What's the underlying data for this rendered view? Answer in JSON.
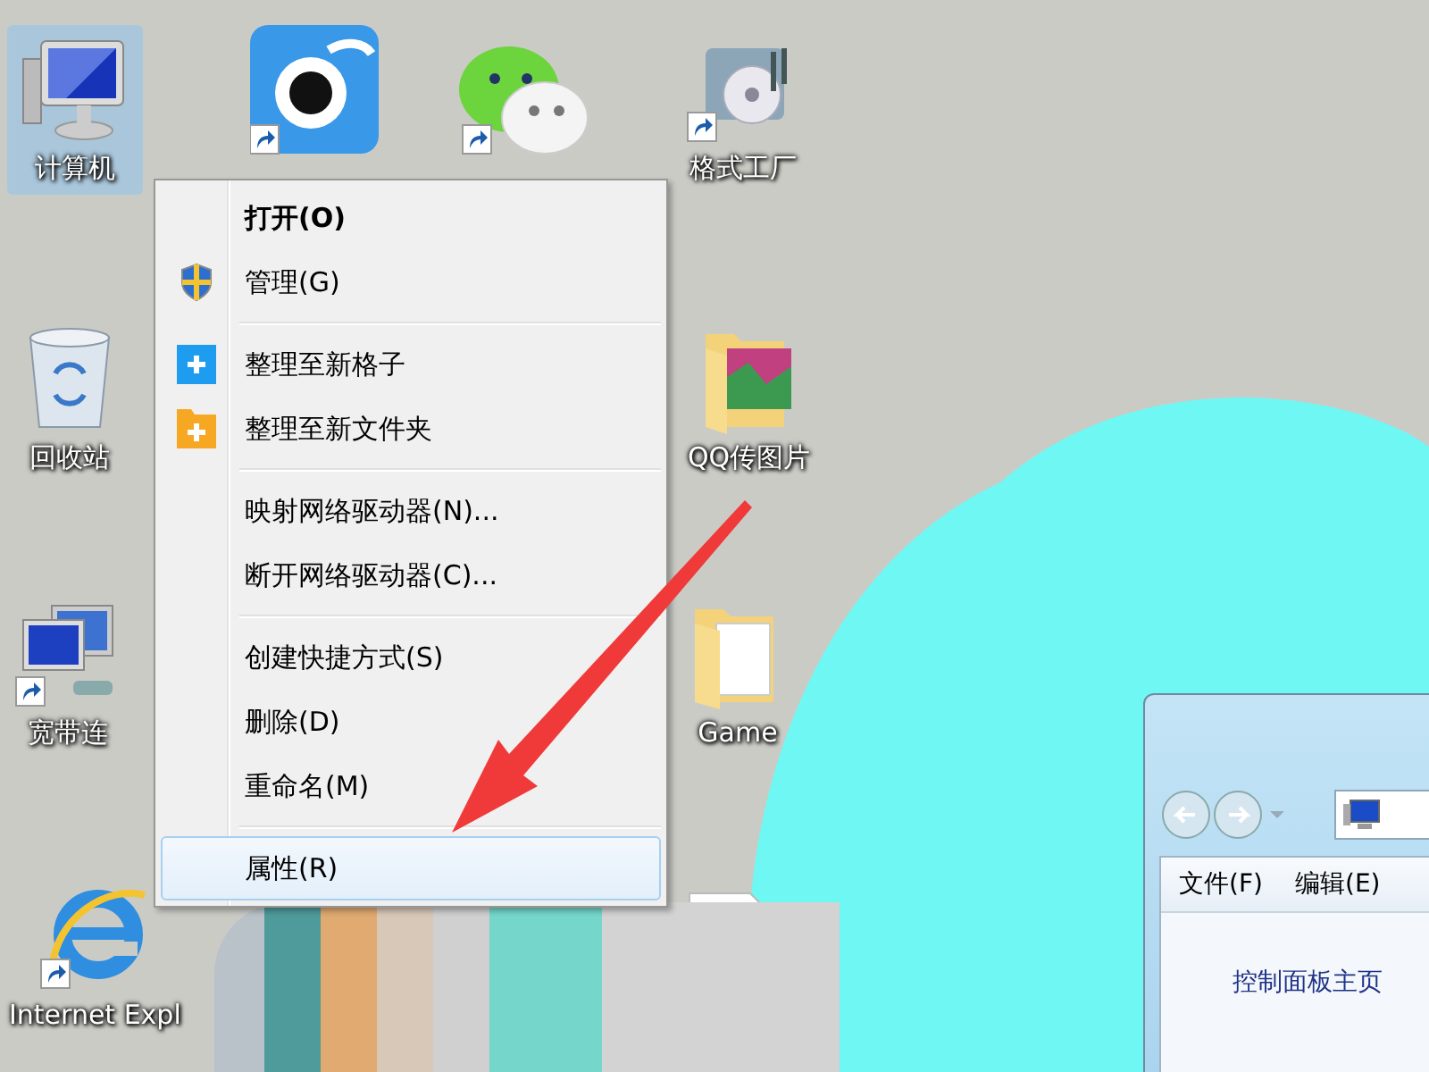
{
  "desktop_icons": [
    {
      "label": "计算机",
      "selected": true
    },
    {
      "label": "格式工厂",
      "selected": false
    },
    {
      "label": "回收站",
      "selected": false
    },
    {
      "label": "QQ传图片",
      "selected": false
    },
    {
      "label": "宽带连",
      "selected": false
    },
    {
      "label": "Game",
      "selected": false
    },
    {
      "label": "Internet Expl",
      "selected": false
    }
  ],
  "context_menu": [
    {
      "kind": "item",
      "label": "打开(O)",
      "default": true,
      "selected": false
    },
    {
      "kind": "item",
      "label": "管理(G)",
      "default": false,
      "selected": false
    },
    {
      "kind": "separator"
    },
    {
      "kind": "item",
      "label": "整理至新格子",
      "default": false,
      "selected": false
    },
    {
      "kind": "item",
      "label": "整理至新文件夹",
      "default": false,
      "selected": false
    },
    {
      "kind": "separator"
    },
    {
      "kind": "item",
      "label": "映射网络驱动器(N)...",
      "default": false,
      "selected": false
    },
    {
      "kind": "item",
      "label": "断开网络驱动器(C)...",
      "default": false,
      "selected": false
    },
    {
      "kind": "separator"
    },
    {
      "kind": "item",
      "label": "创建快捷方式(S)",
      "default": false,
      "selected": false
    },
    {
      "kind": "item",
      "label": "删除(D)",
      "default": false,
      "selected": false
    },
    {
      "kind": "item",
      "label": "重命名(M)",
      "default": false,
      "selected": false
    },
    {
      "kind": "separator"
    },
    {
      "kind": "item",
      "label": "属性(R)",
      "default": false,
      "selected": true
    }
  ],
  "window": {
    "menu": [
      "文件(F)",
      "编辑(E)"
    ],
    "sidebar_link": "控制面板主页"
  }
}
